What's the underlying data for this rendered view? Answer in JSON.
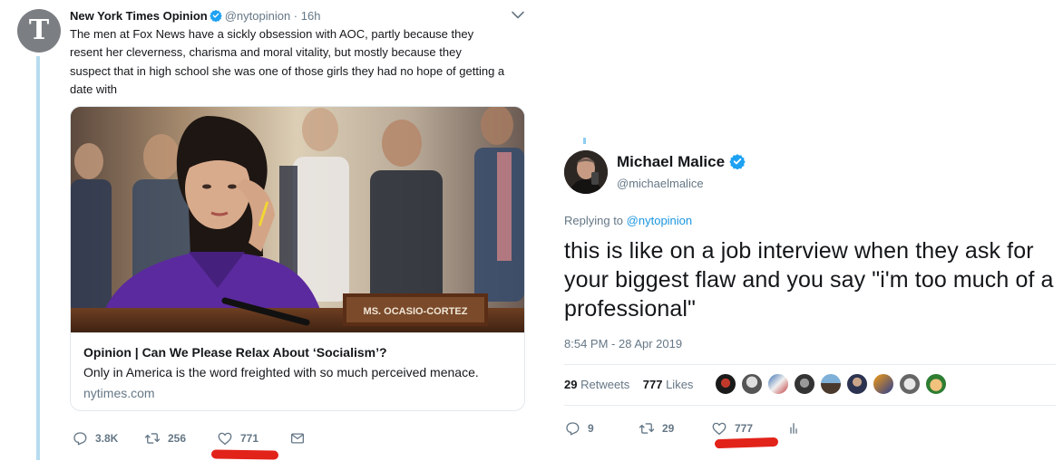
{
  "left_tweet": {
    "avatar_letter": "T",
    "author_name": "New York Times Opinion",
    "author_handle": "@nytopinion",
    "separator": "·",
    "time_ago": "16h",
    "text": "The men at Fox News have a sickly obsession with AOC, partly because they resent her cleverness, charisma and moral vitality, but mostly because they suspect that in high school she was one of those girls they had no hope of getting a date with",
    "card": {
      "image_caption": "MS. OCASIO-CORTEZ",
      "title": "Opinion | Can We Please Relax About ‘Socialism’?",
      "description": "Only in America is the word freighted with so much perceived menace.",
      "domain": "nytimes.com"
    },
    "actions": {
      "replies": "3.8K",
      "retweets": "256",
      "likes": "771"
    }
  },
  "right_tweet": {
    "author_name": "Michael Malice",
    "author_handle": "@michaelmalice",
    "replying_prefix": "Replying to",
    "replying_to": "@nytopinion",
    "text": "this is like on a job interview when they ask for your biggest flaw and you say \"i'm too much of a professional\"",
    "timestamp": "8:54 PM - 28 Apr 2019",
    "retweet_count": "29",
    "retweet_label": "Retweets",
    "like_count": "777",
    "like_label": "Likes",
    "actions": {
      "replies": "9",
      "retweets": "29",
      "likes": "777"
    }
  },
  "colors": {
    "twitter_blue": "#1da1f2",
    "muted_gray": "#657786",
    "annotation_red": "#e2231a",
    "thread_line": "#b7dcef"
  },
  "icons": [
    "verified-badge-icon",
    "chevron-down-icon",
    "reply-icon",
    "retweet-icon",
    "heart-icon",
    "mail-icon",
    "analytics-icon"
  ]
}
